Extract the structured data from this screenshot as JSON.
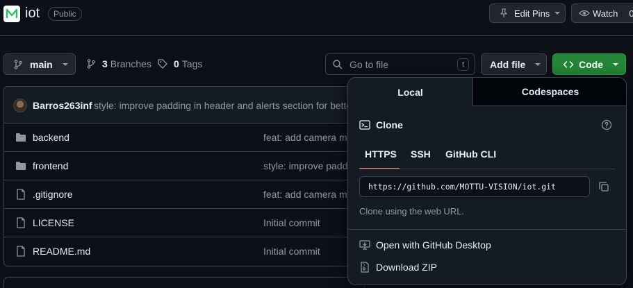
{
  "repo": {
    "name": "iot",
    "visibility": "Public"
  },
  "header": {
    "edit_pins": "Edit Pins",
    "watch": "Watch",
    "watch_count": "0"
  },
  "toolbar": {
    "branch": "main",
    "branches_count": "3",
    "branches_label": "Branches",
    "tags_count": "0",
    "tags_label": "Tags",
    "search_placeholder": "Go to file",
    "search_shortcut": "t",
    "add_file": "Add file",
    "code": "Code"
  },
  "commit": {
    "author": "Barros263inf",
    "message": "style: improve padding in header and alerts section for bette"
  },
  "files": [
    {
      "name": "backend",
      "type": "folder",
      "message": "feat: add camera mo"
    },
    {
      "name": "frontend",
      "type": "folder",
      "message": "style: improve padd"
    },
    {
      "name": ".gitignore",
      "type": "file",
      "message": "feat: add camera mo"
    },
    {
      "name": "LICENSE",
      "type": "file",
      "message": "Initial commit"
    },
    {
      "name": "README.md",
      "type": "file",
      "message": "Initial commit"
    }
  ],
  "code_panel": {
    "tabs": [
      "Local",
      "Codespaces"
    ],
    "clone_title": "Clone",
    "protocols": [
      "HTTPS",
      "SSH",
      "GitHub CLI"
    ],
    "clone_url": "https://github.com/MOTTU-VISION/iot.git",
    "hint": "Clone using the web URL.",
    "open_desktop": "Open with GitHub Desktop",
    "download_zip": "Download ZIP"
  },
  "colors": {
    "accent_green": "#238636",
    "link_blue": "#4493f8",
    "tab_underline": "#f78166"
  }
}
